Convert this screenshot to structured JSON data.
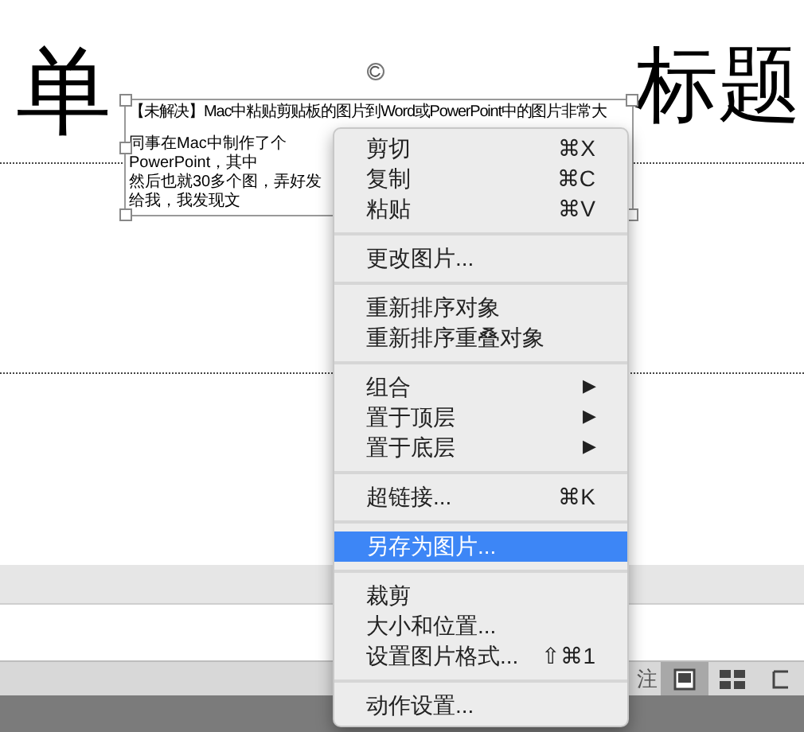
{
  "slide": {
    "title_parts": [
      "单",
      "标题"
    ],
    "picture": {
      "heading": "【未解决】Mac中粘贴剪贴板的图片到Word或PowerPoint中的图片非常大",
      "lines": [
        "同事在Mac中制作了个PowerPoint，其中",
        "然后也就30多个图，弄好发给我，我发现文"
      ]
    }
  },
  "context_menu": {
    "items": [
      {
        "kind": "item",
        "label": "剪切",
        "shortcut": "⌘X",
        "selected": false
      },
      {
        "kind": "item",
        "label": "复制",
        "shortcut": "⌘C",
        "selected": false
      },
      {
        "kind": "item",
        "label": "粘贴",
        "shortcut": "⌘V",
        "selected": false
      },
      {
        "kind": "separator"
      },
      {
        "kind": "item",
        "label": "更改图片...",
        "selected": false
      },
      {
        "kind": "separator"
      },
      {
        "kind": "item",
        "label": "重新排序对象",
        "selected": false
      },
      {
        "kind": "item",
        "label": "重新排序重叠对象",
        "selected": false
      },
      {
        "kind": "separator"
      },
      {
        "kind": "submenu",
        "label": "组合",
        "arrow": "▶",
        "selected": false
      },
      {
        "kind": "submenu",
        "label": "置于顶层",
        "arrow": "▶",
        "selected": false
      },
      {
        "kind": "submenu",
        "label": "置于底层",
        "arrow": "▶",
        "selected": false
      },
      {
        "kind": "separator"
      },
      {
        "kind": "item",
        "label": "超链接...",
        "shortcut": "⌘K",
        "selected": false
      },
      {
        "kind": "separator"
      },
      {
        "kind": "item",
        "label": "另存为图片...",
        "selected": true
      },
      {
        "kind": "separator"
      },
      {
        "kind": "item",
        "label": "裁剪",
        "selected": false
      },
      {
        "kind": "item",
        "label": "大小和位置...",
        "selected": false
      },
      {
        "kind": "item",
        "label": "设置图片格式...",
        "shortcut": "⇧⌘1",
        "selected": false
      },
      {
        "kind": "separator"
      },
      {
        "kind": "item",
        "label": "动作设置...",
        "selected": false
      }
    ]
  },
  "status_bar": {
    "label": "注",
    "views": [
      {
        "kind": "normal",
        "selected": true
      },
      {
        "kind": "sorter",
        "selected": false
      },
      {
        "kind": "reading",
        "selected": false
      }
    ]
  }
}
